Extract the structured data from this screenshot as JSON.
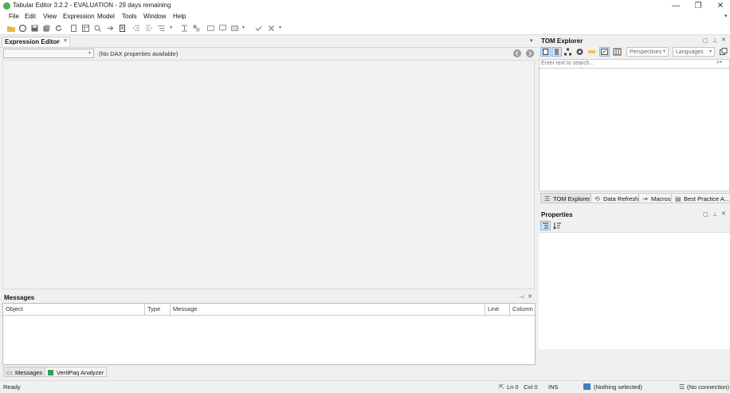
{
  "window": {
    "title": "Tabular Editor 3.2.2 - EVALUATION - 29 days remaining",
    "minimize": "—",
    "restore": "❐",
    "close": "✕",
    "app_icon": "tabular-editor-logo-icon"
  },
  "menu": {
    "items": [
      "File",
      "Edit",
      "View",
      "Expression",
      "Model",
      "Tools",
      "Window",
      "Help"
    ]
  },
  "expression_editor": {
    "title": "Expression Editor",
    "dax_status": "(No DAX properties available)",
    "prev_icon": "back-icon",
    "next_icon": "forward-icon"
  },
  "messages": {
    "title": "Messages",
    "columns": [
      "Object",
      "Type",
      "Message",
      "Line",
      "Column"
    ],
    "rows": [],
    "tabs": [
      "Messages",
      "VertiPaq Analyzer"
    ]
  },
  "tom_explorer": {
    "title": "TOM Explorer",
    "search_placeholder": "Enter text to search...",
    "perspectives": "Perspectives",
    "languages": "Languages",
    "tabs": [
      "TOM Explorer",
      "Data Refresh",
      "Macros",
      "Best Practice A..."
    ]
  },
  "properties": {
    "title": "Properties"
  },
  "status_bar": {
    "ready": "Ready",
    "line": "Ln 0",
    "col": "Col 0",
    "mode": "INS",
    "selection": "(Nothing selected)",
    "connection": "(No connection)"
  },
  "colors": {
    "background": "#f0f0f0",
    "accent_green": "#4caf50",
    "selected_tool": "#cfe3f5"
  }
}
